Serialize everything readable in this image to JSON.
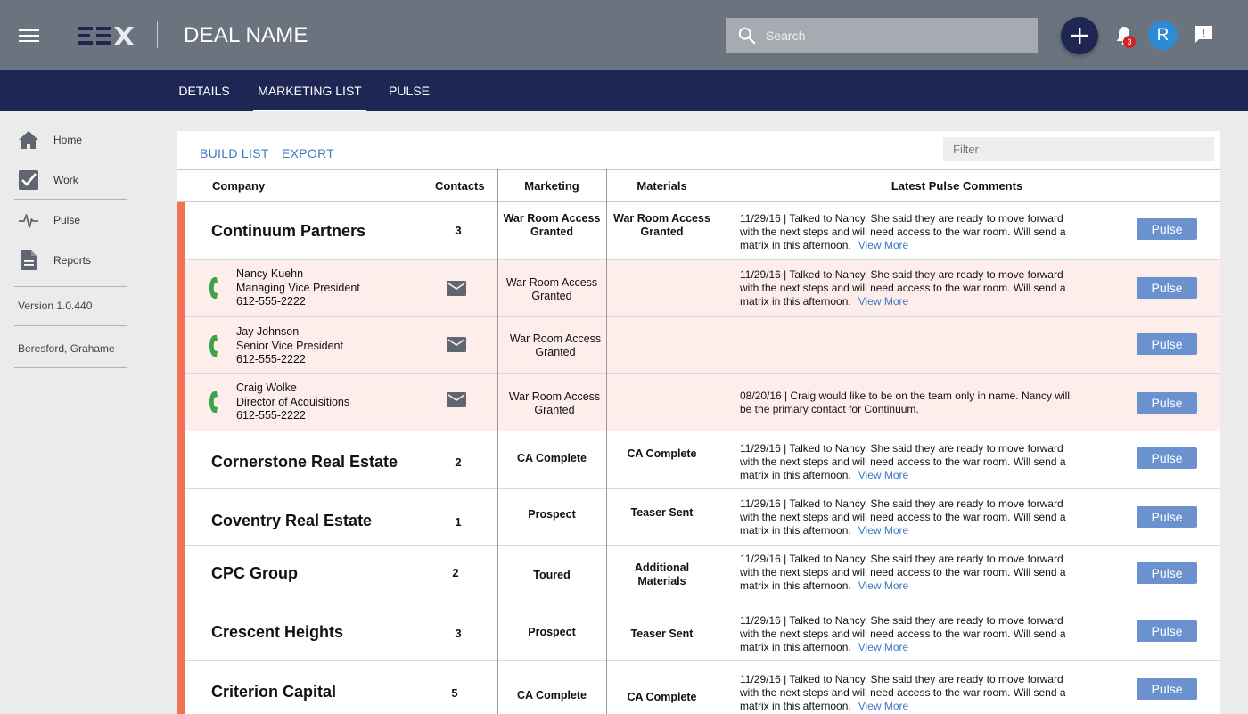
{
  "header": {
    "deal_title": "DEAL NAME",
    "search_placeholder": "Search",
    "notification_count": "3",
    "avatar_initial": "R",
    "colors": {
      "topbar": "#6b737e",
      "navy": "#1e2653",
      "accent": "#f07356",
      "link": "#3e78c1",
      "pulse_button": "#6b92cf",
      "contact_row": "#fdeeec"
    }
  },
  "tabs": [
    {
      "label": "DETAILS"
    },
    {
      "label": "MARKETING LIST",
      "active": true
    },
    {
      "label": "PULSE"
    }
  ],
  "sidebar": {
    "items": [
      {
        "label": "Home",
        "icon": "home-icon"
      },
      {
        "label": "Work",
        "icon": "checkbox-icon"
      },
      {
        "label": "Pulse",
        "icon": "pulse-icon"
      },
      {
        "label": "Reports",
        "icon": "document-icon"
      }
    ],
    "version": "Version 1.0.440",
    "user": "Beresford, Grahame"
  },
  "toolbar": {
    "build_list": "BUILD LIST",
    "export": "EXPORT",
    "filter_placeholder": "Filter"
  },
  "table": {
    "headers": {
      "company": "Company",
      "contacts": "Contacts",
      "marketing": "Marketing",
      "materials": "Materials",
      "comments": "Latest Pulse Comments"
    },
    "view_more": "View More",
    "pulse_label": "Pulse",
    "companies": [
      {
        "name": "Continuum Partners",
        "contacts": "3",
        "marketing": [
          "War Room Access",
          "Granted"
        ],
        "materials": [
          "War Room Access",
          "Granted"
        ],
        "comment": [
          "11/29/16  |  Talked to Nancy.  She said they are ready to move forward",
          "with the next steps and will need access to the war room.  Will send a",
          "matrix in this afternoon."
        ],
        "people": [
          {
            "name": "Nancy Kuehn",
            "title": "Managing Vice President",
            "phone": "612-555-2222",
            "marketing": [
              "War Room Access",
              "Granted"
            ],
            "comment": [
              "11/29/16  |  Talked to Nancy.  She said they are ready to move forward",
              "with the next steps and will need access to the war room.  Will send a",
              "matrix in this afternoon."
            ]
          },
          {
            "name": "Jay Johnson",
            "title": "Senior Vice President",
            "phone": "612-555-2222",
            "marketing": [
              "War Room Access",
              "Granted"
            ],
            "comment": []
          },
          {
            "name": "Craig Wolke",
            "title": "Director of Acquisitions",
            "phone": "612-555-2222",
            "marketing": [
              "War Room Access",
              "Granted"
            ],
            "comment": [
              "08/20/16  |  Craig would like to be on the team only in name.  Nancy will",
              "be the primary contact for Continuum."
            ]
          }
        ]
      },
      {
        "name": "Cornerstone Real Estate",
        "contacts": "2",
        "marketing": [
          "CA Complete"
        ],
        "materials": [
          "CA Complete"
        ],
        "comment": [
          "11/29/16  |  Talked to Nancy.  She said they are ready to move forward",
          "with the next steps and will need access to the war room.  Will send a",
          "matrix in this afternoon."
        ]
      },
      {
        "name": "Coventry Real Estate",
        "contacts": "1",
        "marketing": [
          "Prospect"
        ],
        "materials": [
          "Teaser Sent"
        ],
        "comment": [
          "11/29/16  |  Talked to Nancy.  She said they are ready to move forward",
          "with the next steps and will need access to the war room.  Will send a",
          "matrix in this afternoon."
        ]
      },
      {
        "name": "CPC Group",
        "contacts": "2",
        "marketing": [
          "Toured"
        ],
        "materials": [
          "Additional",
          "Materials"
        ],
        "comment": [
          "11/29/16  |  Talked to Nancy.  She said they are ready to move forward",
          "with the next steps and will need access to the war room.  Will send a",
          "matrix in this afternoon."
        ]
      },
      {
        "name": "Crescent Heights",
        "contacts": "3",
        "marketing": [
          "Prospect"
        ],
        "materials": [
          "Teaser Sent"
        ],
        "comment": [
          "11/29/16  |  Talked to Nancy.  She said they are ready to move forward",
          "with the next steps and will need access to the war room.  Will send a",
          "matrix in this afternoon."
        ]
      },
      {
        "name": "Criterion Capital",
        "contacts": "5",
        "marketing": [
          "CA Complete"
        ],
        "materials": [
          "CA Complete"
        ],
        "comment": [
          "11/29/16  |  Talked to Nancy.  She said they are ready to move forward",
          "with the next steps and will need access to the war room.  Will send a",
          "matrix in this afternoon."
        ]
      }
    ]
  }
}
